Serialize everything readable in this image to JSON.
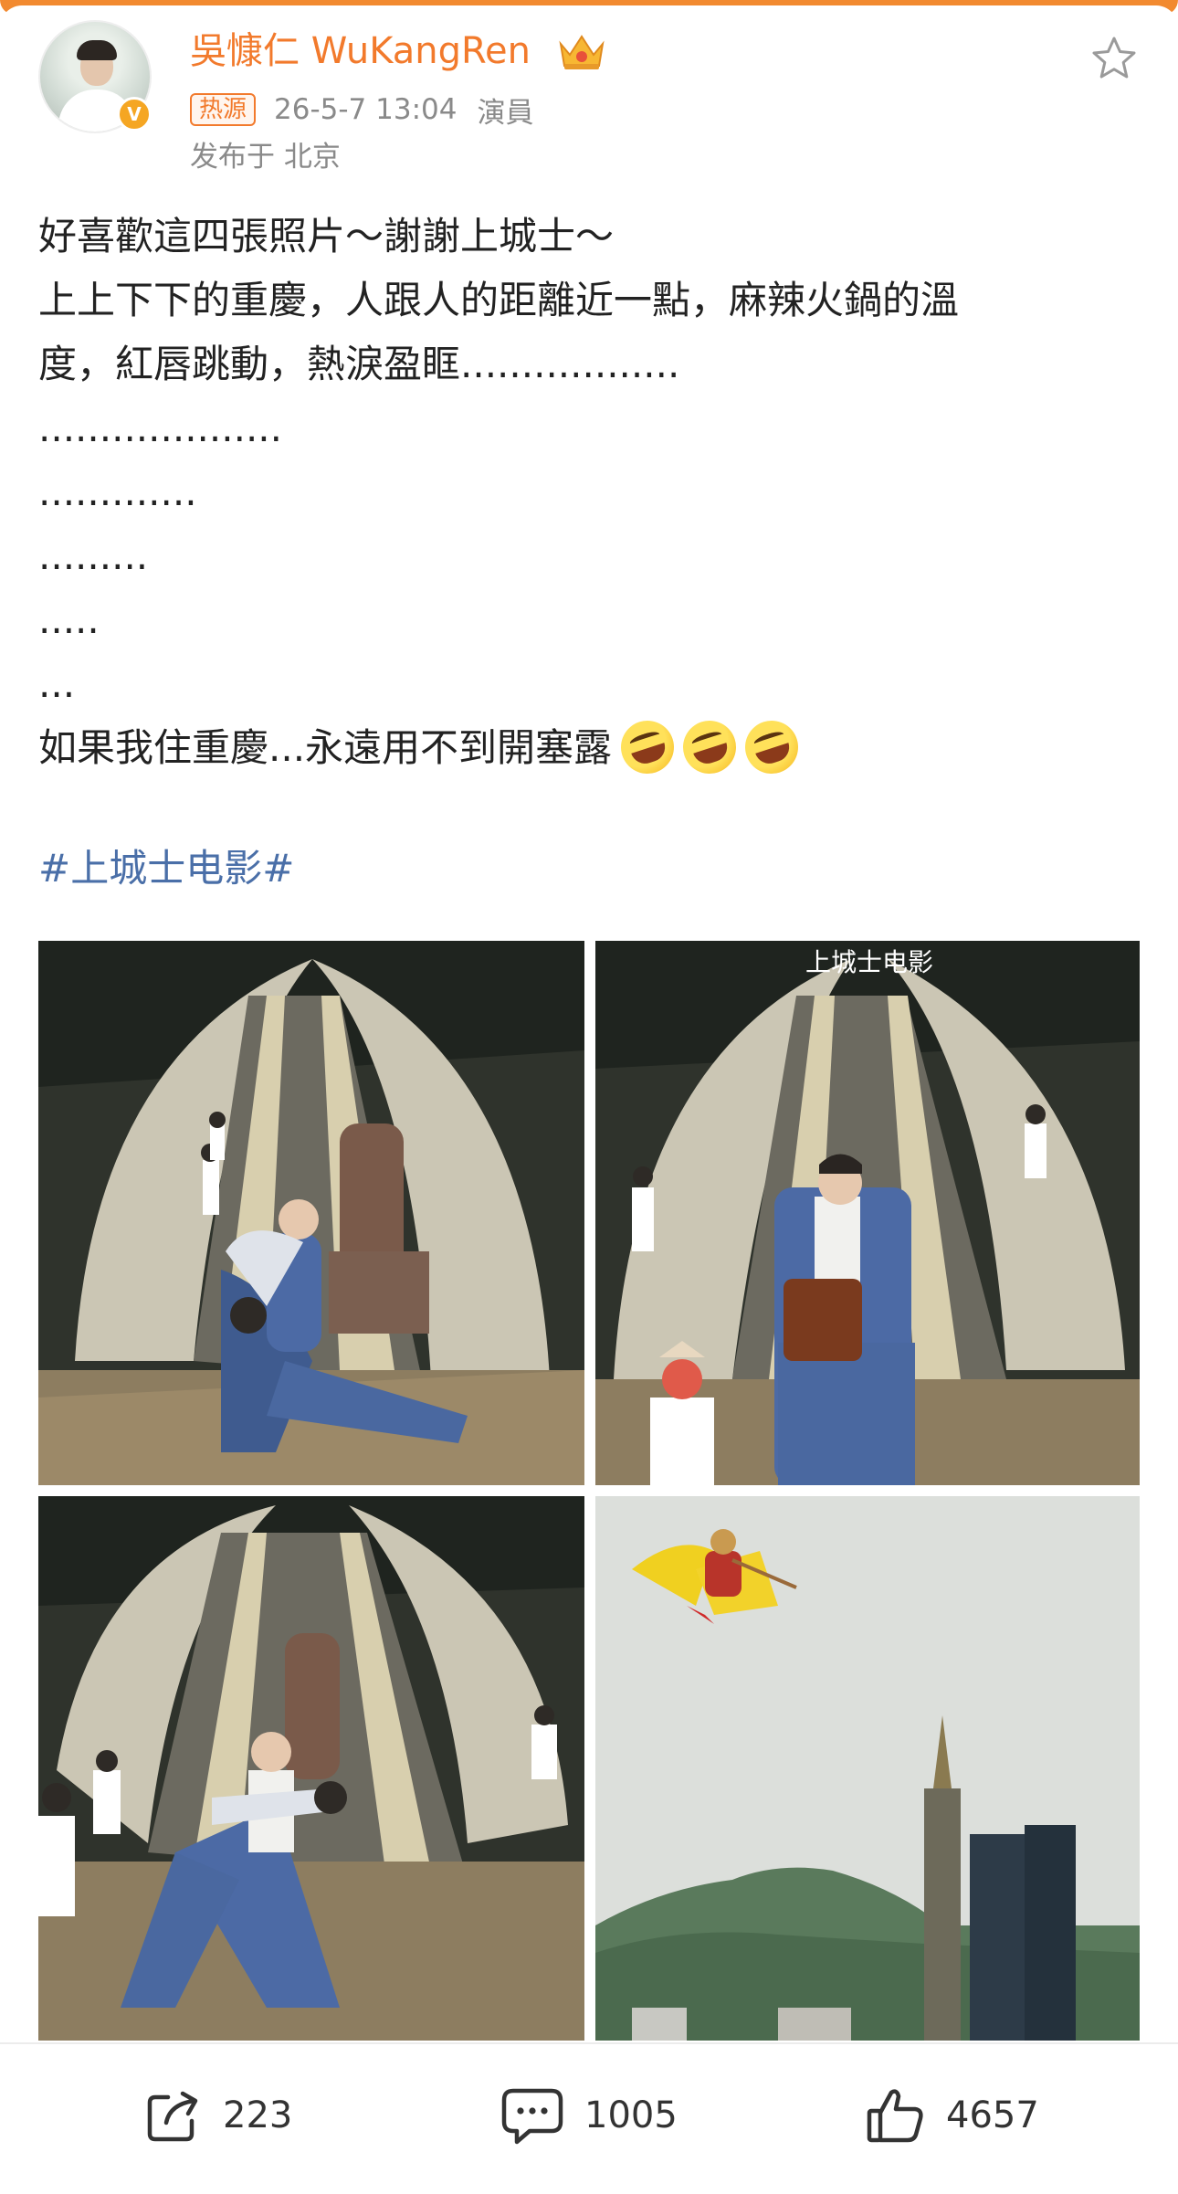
{
  "post": {
    "username": "吳慷仁 WuKangRen",
    "hot_label": "热源",
    "timestamp": "26-5-7 13:04",
    "role": "演員",
    "location": "发布于 北京",
    "lines": [
      "好喜歡這四張照片～謝謝上城士～",
      "上上下下的重慶，人跟人的距離近一點，麻辣火鍋的溫",
      "度，紅唇跳動，熱淚盈眶..................",
      "....................",
      ".............",
      ".........",
      ".....",
      "...",
      "如果我住重慶...永遠用不到開塞露"
    ],
    "hashtag": "#上城士电影#",
    "photo_watermark": "上城士电影"
  },
  "actions": {
    "share_count": "223",
    "comment_count": "1005",
    "like_count": "4657"
  },
  "icons": {
    "favorite": "star-outline-icon",
    "share": "share-icon",
    "comment": "comment-icon",
    "like": "thumbs-up-icon",
    "verified": "verified-v-icon",
    "crown": "crown-badge-icon",
    "emoji": "rolling-laughing-emoji-icon"
  },
  "colors": {
    "accent": "#f27a2c",
    "hashtag": "#4a6fa8",
    "meta": "#8a8a8a",
    "text": "#222222"
  }
}
